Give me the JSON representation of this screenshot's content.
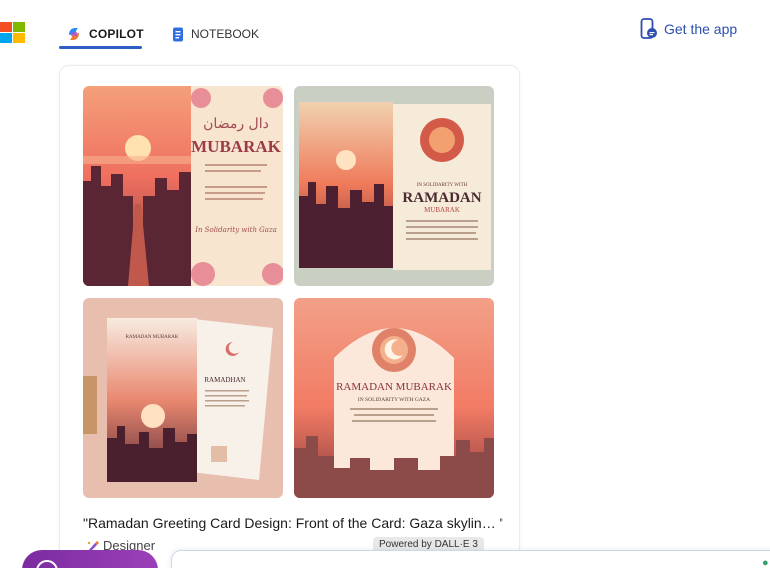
{
  "header": {
    "tabs": [
      {
        "label": "COPILOT",
        "icon": "copilot-icon",
        "active": true
      },
      {
        "label": "NOTEBOOK",
        "icon": "notebook-icon",
        "active": false
      }
    ],
    "get_app_label": "Get the app",
    "accent_color": "#2f5fc4",
    "link_color": "#2d4fae"
  },
  "result": {
    "caption": "\"Ramadan Greeting Card Design: Front of the Card: Gaza skylin… \"",
    "images": [
      {
        "title_lines": [
          "دال رمضان",
          "MUBARAK"
        ],
        "small_text": "In Solidarity with Gaza"
      },
      {
        "title_lines": [
          "RAMADAN",
          "MUBARAK"
        ],
        "small_text": "IN SOLIDARITY WITH"
      },
      {
        "title_lines": [
          "RAMADHAN"
        ],
        "small_text": "RAMADAN MUBARAK"
      },
      {
        "title_lines": [
          "RAMADAN MUBARAK",
          "IN SOLIDARITY WITH GAZA"
        ],
        "small_text": ""
      }
    ],
    "designer_label": "Designer",
    "powered_label": "Powered by DALL·E 3"
  },
  "composer": {
    "new_topic_color": "#8a34ad"
  }
}
